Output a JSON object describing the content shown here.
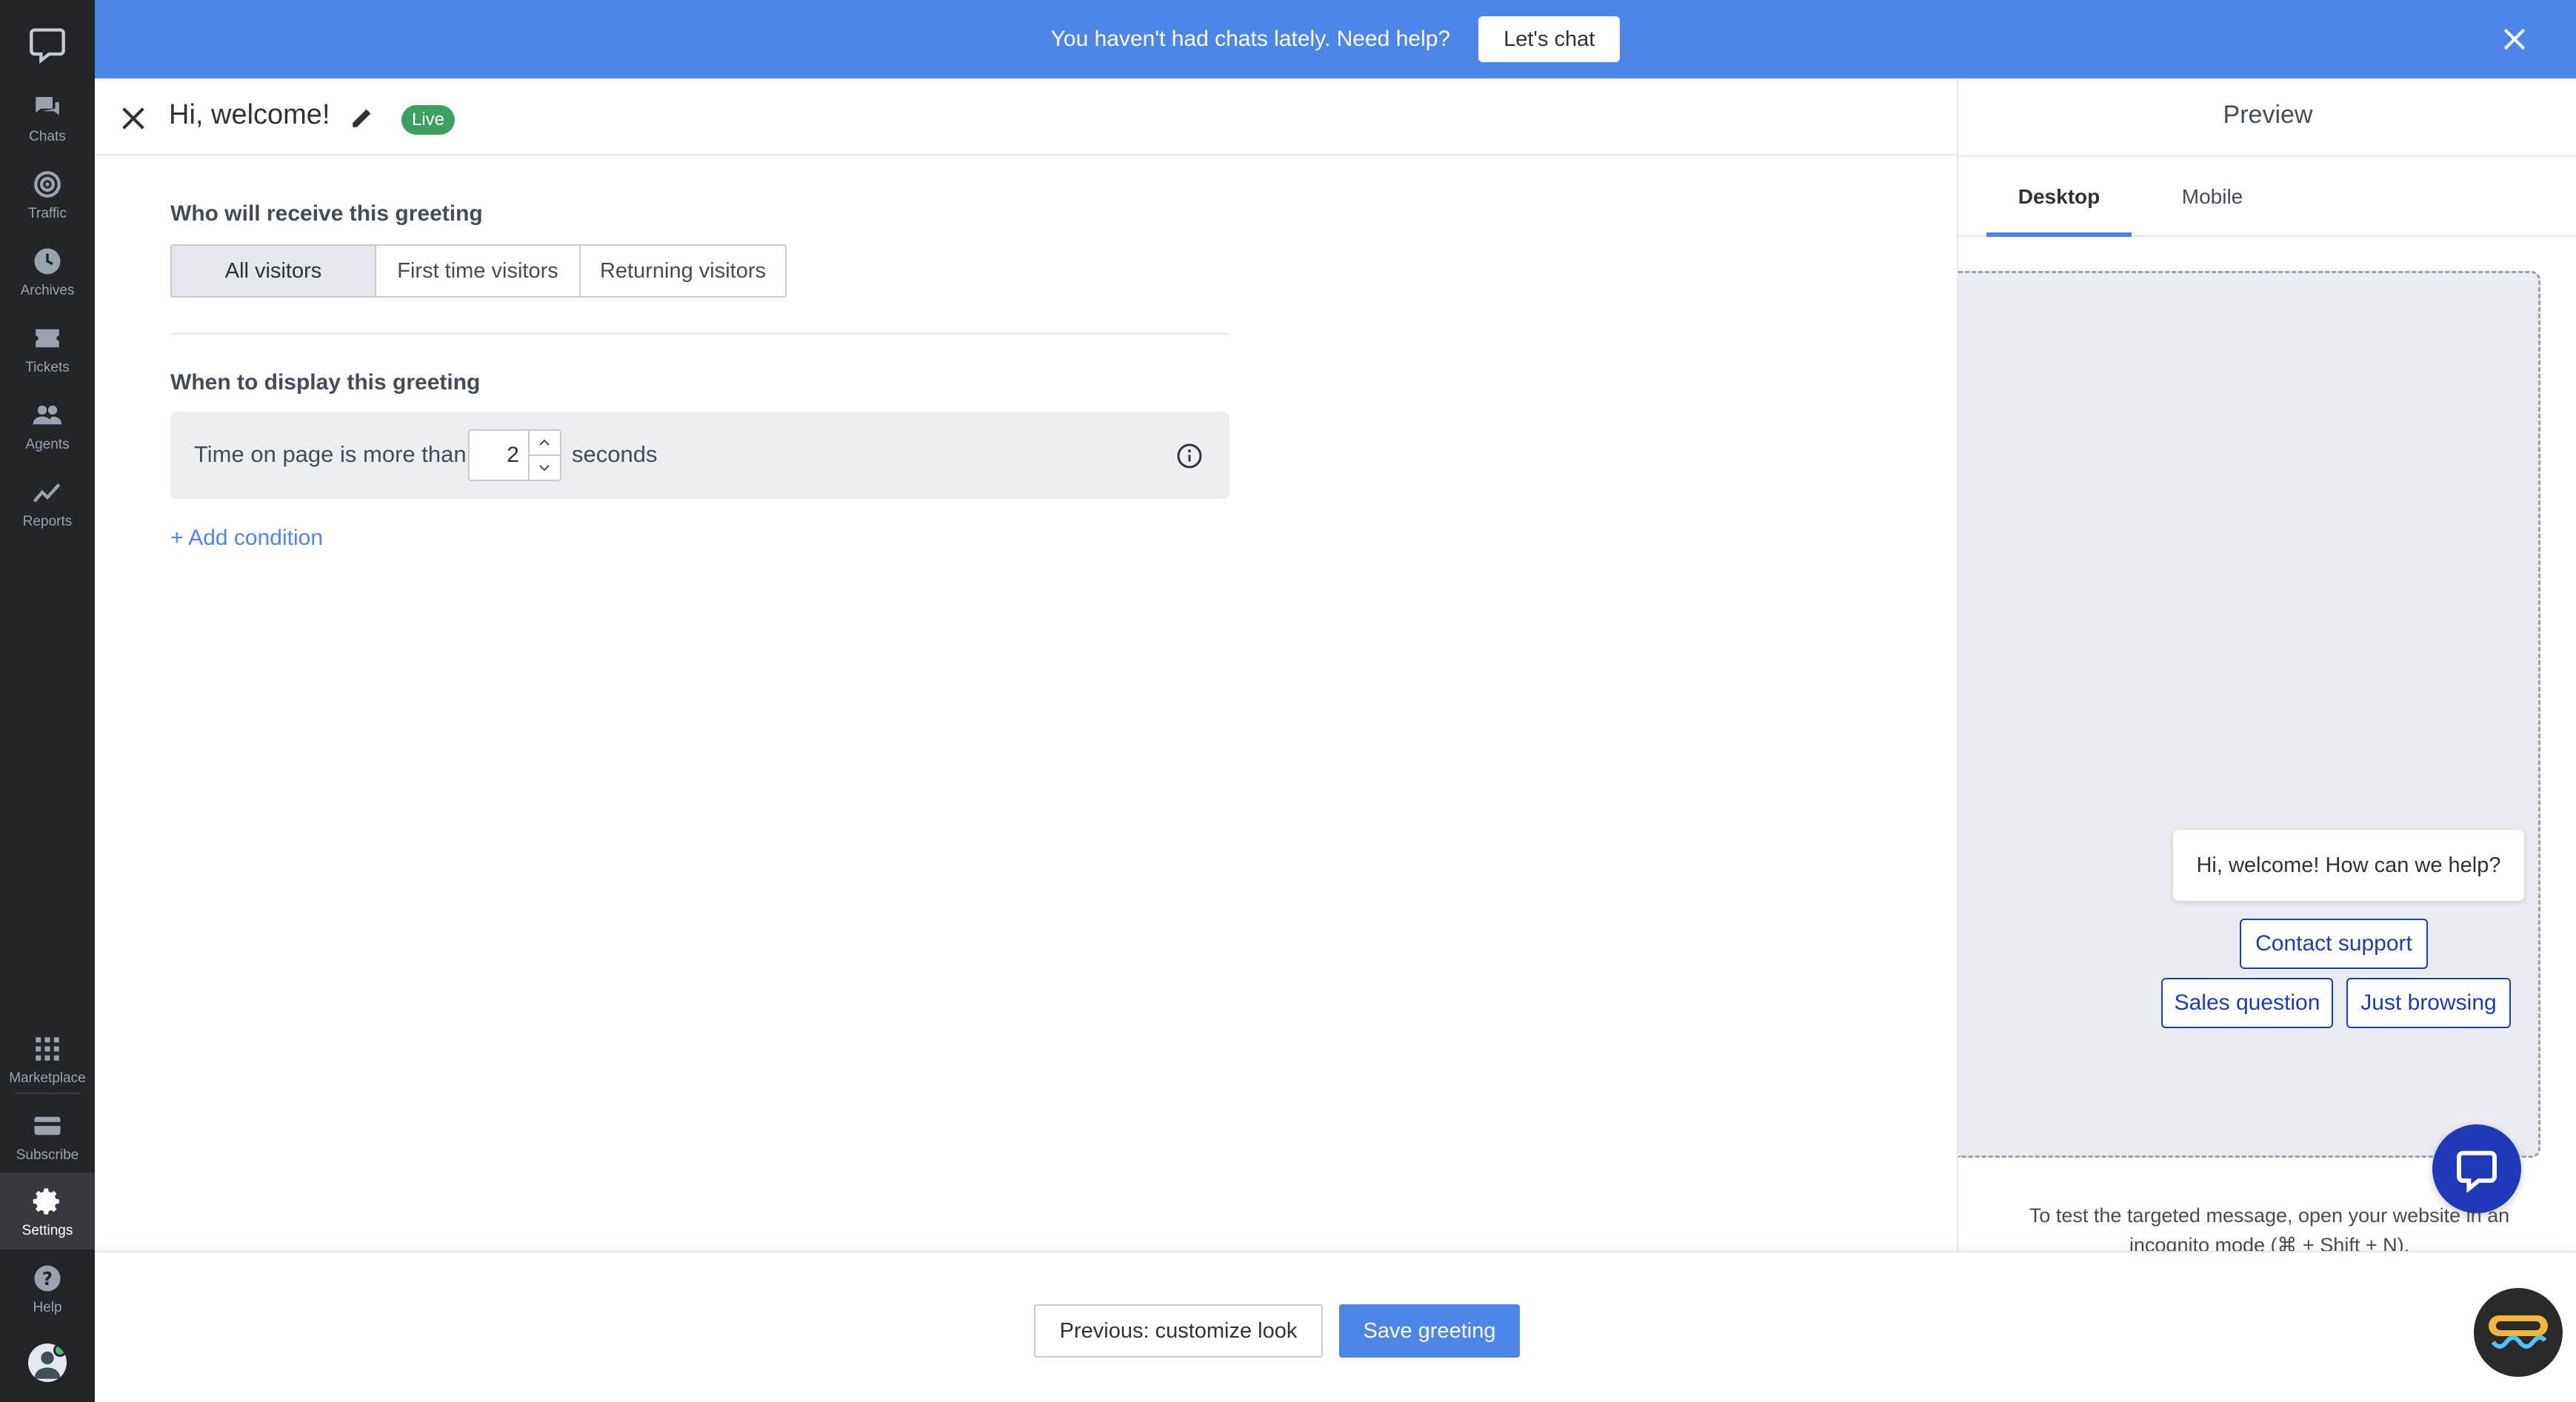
{
  "sidebar": {
    "items": [
      {
        "label": "Chats",
        "icon": "chat-icon"
      },
      {
        "label": "Traffic",
        "icon": "traffic-icon"
      },
      {
        "label": "Archives",
        "icon": "clock-icon"
      },
      {
        "label": "Tickets",
        "icon": "ticket-icon"
      },
      {
        "label": "Agents",
        "icon": "agents-icon"
      },
      {
        "label": "Reports",
        "icon": "reports-icon"
      }
    ],
    "bottom_items": [
      {
        "label": "Marketplace",
        "icon": "grid-icon"
      },
      {
        "label": "Subscribe",
        "icon": "card-icon"
      },
      {
        "label": "Settings",
        "icon": "gear-icon"
      },
      {
        "label": "Help",
        "icon": "help-icon"
      }
    ],
    "active": "Settings"
  },
  "banner": {
    "text": "You haven't had chats lately. Need help?",
    "button_label": "Let's chat"
  },
  "header": {
    "title": "Hi, welcome!",
    "status_badge": "Live"
  },
  "audience": {
    "title": "Who will receive this greeting",
    "options": [
      "All visitors",
      "First time visitors",
      "Returning visitors"
    ],
    "selected": "All visitors"
  },
  "timing": {
    "title": "When to display this greeting",
    "condition_label": "Time on page is more than:",
    "value": "2",
    "unit": "seconds",
    "add_condition": "+ Add condition"
  },
  "preview": {
    "title": "Preview",
    "tabs": [
      "Desktop",
      "Mobile"
    ],
    "active_tab": "Desktop",
    "greeting_message": "Hi, welcome! How can we help?",
    "quick_replies": [
      "Contact support",
      "Sales question",
      "Just browsing"
    ],
    "hint": "To test the targeted message, open your website in an incognito mode (⌘ + Shift + N)."
  },
  "footer": {
    "prev_label": "Previous: customize look",
    "save_label": "Save greeting"
  },
  "colors": {
    "accent": "#4e86e8",
    "live_green": "#3d9f62",
    "widget_blue": "#1f3ab8",
    "sidebar_bg": "#232529"
  }
}
